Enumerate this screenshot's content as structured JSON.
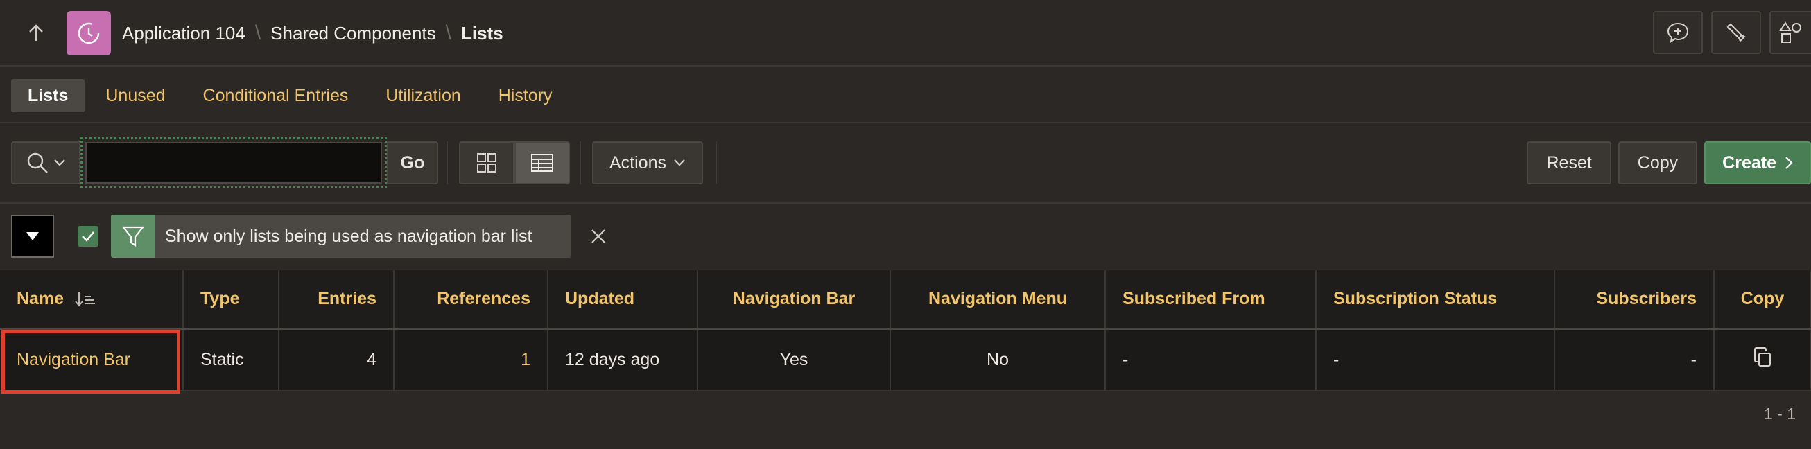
{
  "breadcrumb": {
    "app": "Application 104",
    "section": "Shared Components",
    "current": "Lists"
  },
  "tabs": [
    {
      "label": "Lists",
      "active": true
    },
    {
      "label": "Unused",
      "active": false
    },
    {
      "label": "Conditional Entries",
      "active": false
    },
    {
      "label": "Utilization",
      "active": false
    },
    {
      "label": "History",
      "active": false
    }
  ],
  "toolbar": {
    "search_value": "",
    "go_label": "Go",
    "actions_label": "Actions",
    "reset_label": "Reset",
    "copy_label": "Copy",
    "create_label": "Create"
  },
  "filter": {
    "text": "Show only lists being used as navigation bar list",
    "checked": true
  },
  "table": {
    "columns": [
      "Name",
      "Type",
      "Entries",
      "References",
      "Updated",
      "Navigation Bar",
      "Navigation Menu",
      "Subscribed From",
      "Subscription Status",
      "Subscribers",
      "Copy"
    ],
    "rows": [
      {
        "name": "Navigation Bar",
        "type": "Static",
        "entries": "4",
        "references": "1",
        "updated": "12 days ago",
        "navigation_bar": "Yes",
        "navigation_menu": "No",
        "subscribed_from": "-",
        "subscription_status": "-",
        "subscribers": "-"
      }
    ]
  },
  "pagination": "1 - 1",
  "colors": {
    "accent": "#f2c46b",
    "create": "#497e55",
    "highlight": "#e0412f",
    "app_icon": "#c76fb0"
  }
}
